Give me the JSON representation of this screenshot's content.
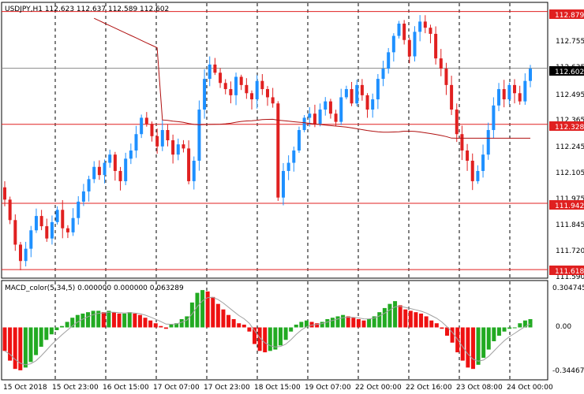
{
  "colors": {
    "bull": "#1e90ff",
    "bear": "#e02020",
    "level": "#e02020",
    "ma": "#b01010",
    "macd_pos": "#22aa22",
    "macd_neg": "#ee1111",
    "signal": "#a0a0a0",
    "price_tag": "#000000"
  },
  "main": {
    "title": "USDJPY,H1  112.623 112.637 112.589 112.602",
    "y_ticks": [
      "112.875",
      "112.755",
      "112.635",
      "112.495",
      "112.365",
      "112.245",
      "112.105",
      "111.975",
      "111.845",
      "111.720",
      "111.590"
    ],
    "levels": [
      {
        "label": "112.879",
        "value": 112.879
      },
      {
        "label": "112.328",
        "value": 112.328
      },
      {
        "label": "111.942",
        "value": 111.942
      },
      {
        "label": "111.618",
        "value": 111.618
      }
    ],
    "current_price": {
      "label": "112.602",
      "value": 112.602
    }
  },
  "macd": {
    "title": "MACD_color(5,34,5) 0.000000 0.000000 0.063289",
    "y_ticks": [
      "0.304745",
      "0.00",
      "-0.344671"
    ]
  },
  "x_ticks": [
    "15 Oct 2018",
    "15 Oct 23:00",
    "16 Oct 15:00",
    "17 Oct 07:00",
    "17 Oct 23:00",
    "18 Oct 15:00",
    "19 Oct 07:00",
    "22 Oct 00:00",
    "22 Oct 16:00",
    "23 Oct 08:00",
    "24 Oct 00:00"
  ],
  "chart_data": [
    {
      "type": "candlestick",
      "title": "USDJPY,H1",
      "ohlc_last": {
        "open": 112.623,
        "high": 112.637,
        "low": 112.589,
        "close": 112.602
      },
      "ylim": [
        111.58,
        112.92
      ],
      "horizontal_levels": [
        112.879,
        112.328,
        111.942,
        111.618
      ],
      "close_series": [
        111.96,
        111.86,
        111.74,
        111.66,
        111.72,
        111.81,
        111.88,
        111.83,
        111.77,
        111.85,
        111.91,
        111.82,
        111.8,
        111.87,
        111.95,
        112.0,
        112.06,
        112.12,
        112.08,
        112.14,
        112.18,
        112.1,
        112.05,
        112.16,
        112.2,
        112.28,
        112.36,
        112.33,
        112.27,
        112.22,
        112.3,
        112.25,
        112.18,
        112.23,
        112.21,
        112.05,
        112.15,
        112.4,
        112.55,
        112.62,
        112.58,
        112.53,
        112.5,
        112.47,
        112.56,
        112.52,
        112.48,
        112.45,
        112.54,
        112.5,
        112.46,
        112.43,
        111.97,
        112.1,
        112.14,
        112.2,
        112.3,
        112.36,
        112.38,
        112.33,
        112.4,
        112.44,
        112.38,
        112.34,
        112.46,
        112.5,
        112.43,
        112.52,
        112.47,
        112.4,
        112.45,
        112.55,
        112.6,
        112.68,
        112.76,
        112.82,
        112.74,
        112.66,
        112.78,
        112.83,
        112.8,
        112.77,
        112.65,
        112.6,
        112.52,
        112.4,
        112.28,
        112.2,
        112.15,
        112.05,
        112.1,
        112.18,
        112.3,
        112.42,
        112.5,
        112.45,
        112.52,
        112.48,
        112.44,
        112.54,
        112.6
      ]
    },
    {
      "type": "bar",
      "title": "MACD_color(5,34,5)",
      "ylim": [
        -0.344671,
        0.304745
      ],
      "values": [
        -0.17,
        -0.24,
        -0.3,
        -0.31,
        -0.29,
        -0.25,
        -0.2,
        -0.14,
        -0.09,
        -0.05,
        -0.02,
        0.01,
        0.04,
        0.07,
        0.09,
        0.1,
        0.11,
        0.12,
        0.12,
        0.11,
        0.12,
        0.11,
        0.1,
        0.1,
        0.11,
        0.1,
        0.09,
        0.07,
        0.05,
        0.03,
        0.01,
        -0.01,
        0.02,
        0.03,
        0.06,
        0.08,
        0.18,
        0.25,
        0.27,
        0.26,
        0.22,
        0.17,
        0.13,
        0.09,
        0.06,
        0.03,
        0.02,
        -0.03,
        -0.12,
        -0.17,
        -0.18,
        -0.17,
        -0.16,
        -0.13,
        -0.09,
        -0.03,
        0.02,
        0.04,
        0.05,
        0.04,
        0.03,
        0.04,
        0.06,
        0.07,
        0.08,
        0.09,
        0.08,
        0.07,
        0.06,
        0.05,
        0.06,
        0.08,
        0.11,
        0.14,
        0.17,
        0.19,
        0.16,
        0.13,
        0.12,
        0.11,
        0.1,
        0.08,
        0.05,
        0.03,
        -0.01,
        -0.06,
        -0.11,
        -0.18,
        -0.24,
        -0.29,
        -0.3,
        -0.27,
        -0.22,
        -0.16,
        -0.1,
        -0.06,
        -0.03,
        -0.01,
        0.0,
        0.03,
        0.05,
        0.06
      ]
    }
  ]
}
